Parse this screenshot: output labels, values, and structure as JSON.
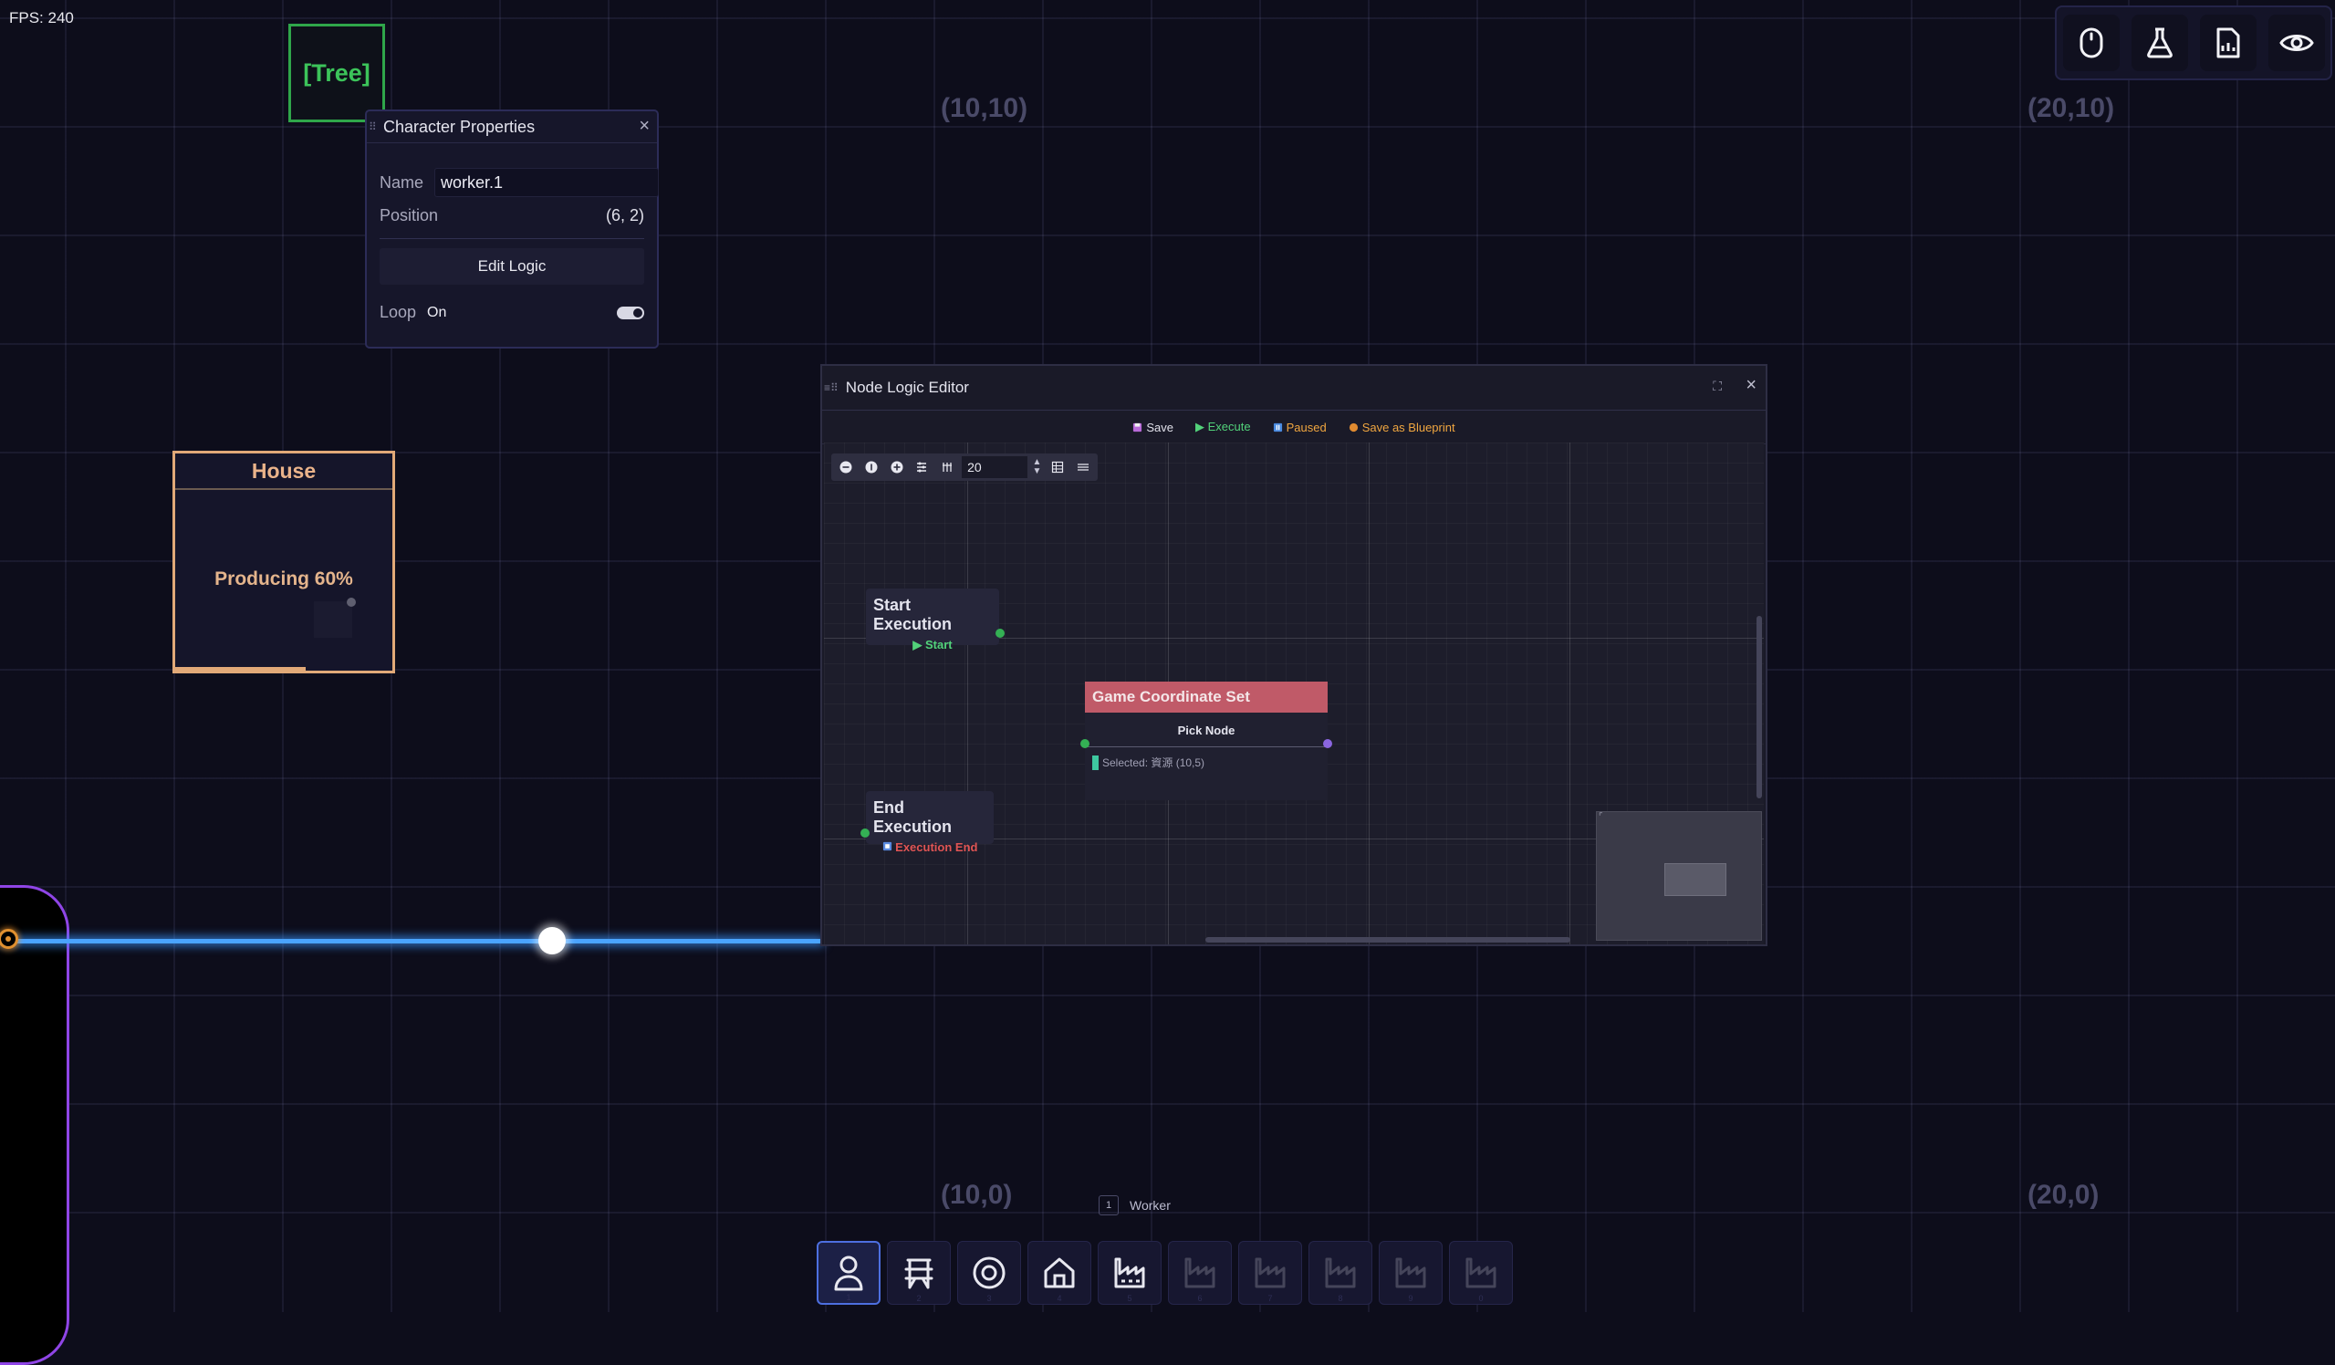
{
  "fps": "FPS: 240",
  "world": {
    "coords": [
      "(10,10)",
      "(20,10)",
      "(10,0)",
      "(20,0)"
    ],
    "tree_label": "[Tree]",
    "house": {
      "title": "House",
      "status": "Producing 60%",
      "progress": 0.6
    }
  },
  "character_panel": {
    "title": "Character Properties",
    "close": "×",
    "name_label": "Name",
    "name_value": "worker.1",
    "position_label": "Position",
    "position_value": "(6, 2)",
    "edit_logic": "Edit Logic",
    "loop_label": "Loop",
    "loop_value": "On"
  },
  "editor": {
    "title": "Node Logic Editor",
    "maximize": "⛶",
    "close": "×",
    "actions": {
      "save": "Save",
      "execute": "▶ Execute",
      "paused": "Paused",
      "blueprint": "Save as Blueprint"
    },
    "zoom_value": "20",
    "nodes": {
      "start_title": "Start Execution",
      "start_label": "▶ Start",
      "end_title": "End Execution",
      "end_label": "Execution End",
      "coord_title": "Game Coordinate Set",
      "coord_sub": "Pick Node",
      "coord_selected": "Selected: 資源 (10,5)"
    }
  },
  "hotbar": {
    "label_key": "1",
    "label": "Worker",
    "slots": [
      {
        "icon": "person-icon",
        "num": "1"
      },
      {
        "icon": "bench-icon",
        "num": "2"
      },
      {
        "icon": "target-icon",
        "num": "3"
      },
      {
        "icon": "house-icon",
        "num": "4"
      },
      {
        "icon": "factory-icon",
        "num": "5"
      },
      {
        "icon": "factory-icon",
        "num": "6"
      },
      {
        "icon": "factory-icon",
        "num": "7"
      },
      {
        "icon": "factory-icon",
        "num": "8"
      },
      {
        "icon": "factory-icon",
        "num": "9"
      },
      {
        "icon": "factory-icon",
        "num": "0"
      }
    ]
  },
  "toolbar_icons": [
    "mouse-icon",
    "flask-icon",
    "document-chart-icon",
    "eye-icon"
  ],
  "colors": {
    "background": "#0d0d1b",
    "tree": "#2fa64a",
    "house": "#e1a978",
    "energy": "#4aa4ff",
    "accent": "#4d6fe0",
    "execute": "#52d27a",
    "paused": "#f0a640",
    "coord_node": "#c05a68"
  }
}
